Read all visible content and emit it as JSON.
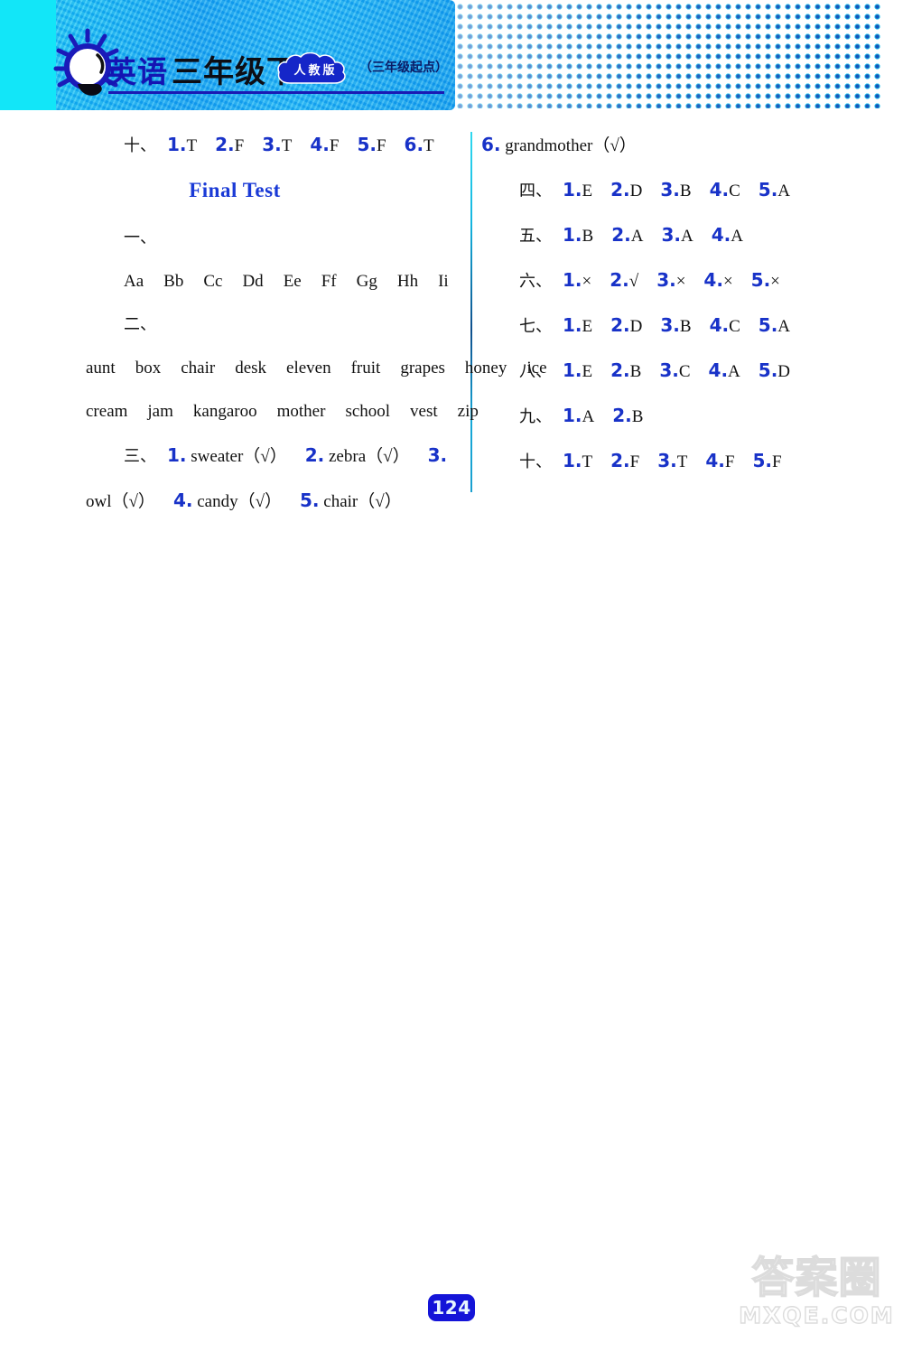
{
  "header": {
    "subject": "英语",
    "grade": "三年级下",
    "edition_badge": "人教版",
    "start_note": "（三年级起点）",
    "bulb_icon": "lightbulb-icon"
  },
  "left_column": {
    "section_ten": {
      "marker": "十、",
      "items": [
        {
          "num": "1.",
          "ans": "T"
        },
        {
          "num": "2.",
          "ans": "F"
        },
        {
          "num": "3.",
          "ans": "T"
        },
        {
          "num": "4.",
          "ans": "F"
        },
        {
          "num": "5.",
          "ans": "F"
        },
        {
          "num": "6.",
          "ans": "T"
        }
      ]
    },
    "heading": "Final Test",
    "section_one": {
      "marker": "一、",
      "letters": [
        "Aa",
        "Bb",
        "Cc",
        "Dd",
        "Ee",
        "Ff",
        "Gg",
        "Hh",
        "Ii"
      ]
    },
    "section_two": {
      "marker": "二、",
      "words": [
        "aunt",
        "box",
        "chair",
        "desk",
        "eleven",
        "fruit",
        "grapes",
        "honey",
        "ice cream",
        "jam",
        "kangaroo",
        "mother",
        "school",
        "vest",
        "zip"
      ]
    },
    "section_three": {
      "marker": "三、",
      "items": [
        {
          "num": "1.",
          "word": "sweater",
          "mark": "（√）"
        },
        {
          "num": "2.",
          "word": "zebra",
          "mark": "（√）"
        },
        {
          "num": "3.",
          "word": "owl",
          "mark": "（√）"
        },
        {
          "num": "4.",
          "word": "candy",
          "mark": "（√）"
        },
        {
          "num": "5.",
          "word": "chair",
          "mark": "（√）"
        }
      ]
    }
  },
  "right_column": {
    "section_three_cont": {
      "num": "6.",
      "word": "grandmother",
      "mark": "（√）"
    },
    "section_four": {
      "marker": "四、",
      "items": [
        {
          "num": "1.",
          "ans": "E"
        },
        {
          "num": "2.",
          "ans": "D"
        },
        {
          "num": "3.",
          "ans": "B"
        },
        {
          "num": "4.",
          "ans": "C"
        },
        {
          "num": "5.",
          "ans": "A"
        }
      ]
    },
    "section_five": {
      "marker": "五、",
      "items": [
        {
          "num": "1.",
          "ans": "B"
        },
        {
          "num": "2.",
          "ans": "A"
        },
        {
          "num": "3.",
          "ans": "A"
        },
        {
          "num": "4.",
          "ans": "A"
        }
      ]
    },
    "section_six": {
      "marker": "六、",
      "items": [
        {
          "num": "1.",
          "ans": "×"
        },
        {
          "num": "2.",
          "ans": "√"
        },
        {
          "num": "3.",
          "ans": "×"
        },
        {
          "num": "4.",
          "ans": "×"
        },
        {
          "num": "5.",
          "ans": "×"
        }
      ]
    },
    "section_seven": {
      "marker": "七、",
      "items": [
        {
          "num": "1.",
          "ans": "E"
        },
        {
          "num": "2.",
          "ans": "D"
        },
        {
          "num": "3.",
          "ans": "B"
        },
        {
          "num": "4.",
          "ans": "C"
        },
        {
          "num": "5.",
          "ans": "A"
        }
      ]
    },
    "section_eight": {
      "marker": "八、",
      "items": [
        {
          "num": "1.",
          "ans": "E"
        },
        {
          "num": "2.",
          "ans": "B"
        },
        {
          "num": "3.",
          "ans": "C"
        },
        {
          "num": "4.",
          "ans": "A"
        },
        {
          "num": "5.",
          "ans": "D"
        }
      ]
    },
    "section_nine": {
      "marker": "九、",
      "items": [
        {
          "num": "1.",
          "ans": "A"
        },
        {
          "num": "2.",
          "ans": "B"
        }
      ]
    },
    "section_ten": {
      "marker": "十、",
      "items": [
        {
          "num": "1.",
          "ans": "T"
        },
        {
          "num": "2.",
          "ans": "F"
        },
        {
          "num": "3.",
          "ans": "T"
        },
        {
          "num": "4.",
          "ans": "F"
        },
        {
          "num": "5.",
          "ans": "F"
        }
      ]
    }
  },
  "footer": {
    "page_number": "124",
    "watermark_cn": "答案圈",
    "watermark_en": "MXQE.COM"
  }
}
